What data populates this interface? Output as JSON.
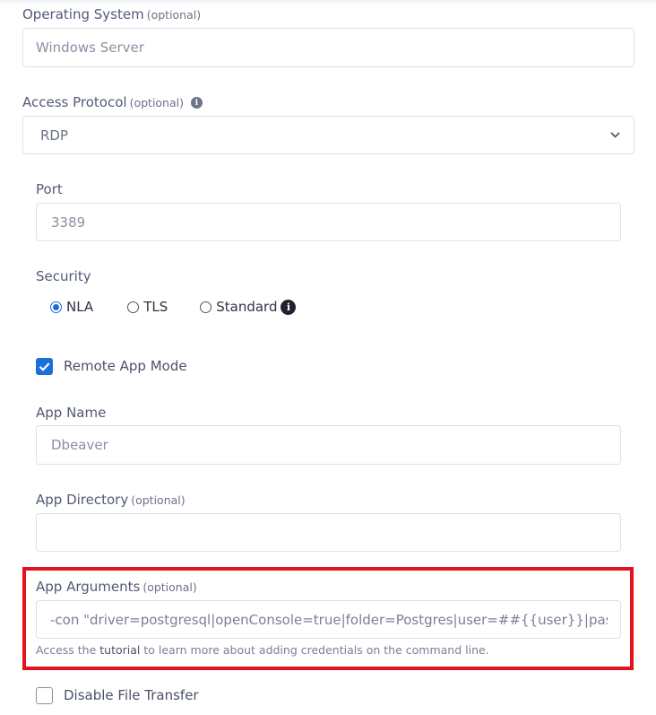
{
  "operating_system": {
    "label": "Operating System",
    "optional": "(optional)",
    "value": "Windows Server"
  },
  "access_protocol": {
    "label": "Access Protocol",
    "optional": "(optional)",
    "selected": "RDP",
    "icon": "info-icon"
  },
  "port": {
    "label": "Port",
    "value": "3389"
  },
  "security": {
    "label": "Security",
    "options": [
      {
        "label": "NLA",
        "checked": true
      },
      {
        "label": "TLS",
        "checked": false
      },
      {
        "label": "Standard",
        "checked": false
      }
    ],
    "icon": "info-icon"
  },
  "remote_app_mode": {
    "label": "Remote App Mode",
    "checked": true
  },
  "app_name": {
    "label": "App Name",
    "value": "Dbeaver"
  },
  "app_directory": {
    "label": "App Directory",
    "optional": "(optional)",
    "value": ""
  },
  "app_arguments": {
    "label": "App Arguments",
    "optional": "(optional)",
    "value": "-con \"driver=postgresql|openConsole=true|folder=Postgres|user=##{{user}}|password",
    "help_prefix": "Access the",
    "help_link": "tutorial",
    "help_suffix": "to learn more about adding credentials on the command line."
  },
  "disable_file_transfer": {
    "label": "Disable File Transfer",
    "checked": false
  },
  "colors": {
    "accent": "#1b6fd9",
    "highlight_border": "#e1131b"
  }
}
